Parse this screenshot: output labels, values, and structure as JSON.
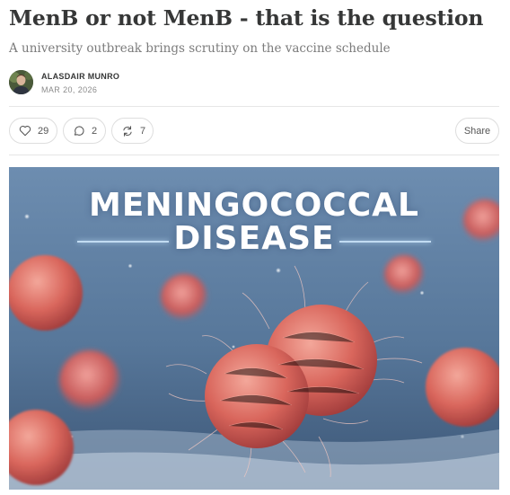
{
  "article": {
    "title": "MenB or not MenB - that is the question",
    "subtitle": "A university outbreak brings scrutiny on the vaccine schedule"
  },
  "author": {
    "name": "ALASDAIR MUNRO",
    "date": "MAR 20, 2026"
  },
  "actions": {
    "likes": "29",
    "comments": "2",
    "restacks": "7",
    "share_label": "Share"
  },
  "hero_image": {
    "line1": "MENINGOCOCCAL",
    "line2": "DISEASE"
  },
  "icons": {
    "like": "heart-icon",
    "comment": "comment-bubble-icon",
    "restack": "restack-arrows-icon"
  }
}
